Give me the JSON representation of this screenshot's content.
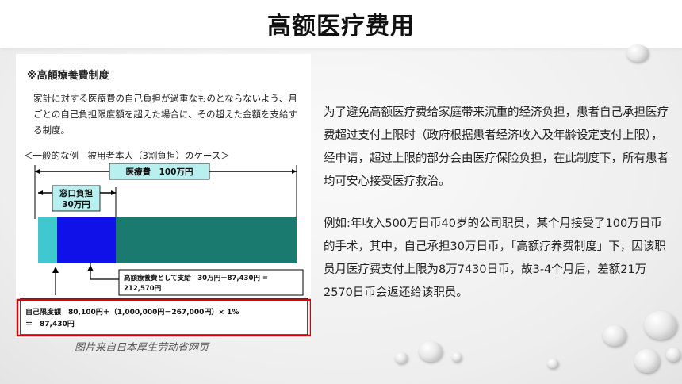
{
  "slide": {
    "title": "高额医疗费用",
    "caption": "图片来自日本厚生劳动省网页",
    "paragraphs": [
      "为了避免高额医疗费给家庭带来沉重的经济负担，患者自己承担医疗费超过支付上限时（政府根据患者经济收入及年龄设定支付上限），经申请，超过上限的部分会由医疗保险负担，在此制度下，所有患者均可安心接受医疗救治。",
      "例如:年收入500万日币40岁的公司职员，某个月接受了100万日币的手术，其中，自己承担30万日币，「高额疗养费制度」下，因该职员月医疗费支付上限为8万7430日币，故3-4个月后，差额21万2570日币会返还给该职员。"
    ]
  },
  "document": {
    "heading": "※高額療養費制度",
    "description": "家計に対する医療費の自己負担が過重なものとならないよう、月ごとの自己負担限度額を超えた場合に、その超えた金額を支給する制度。",
    "example_title": "＜一般的な例　被用者本人（3割負担）のケース＞",
    "total_label": "医療費　100万円",
    "window_label_1": "窓口負担",
    "window_label_2": "30万円",
    "benefit_line_1": "高額療養費として支給　30万円－87,430円 =",
    "benefit_line_2": "212,570円",
    "limit_line_1": "自己限度額　80,100円＋（1,000,000円－267,000円）× 1%",
    "limit_line_2": "＝　87,430円"
  },
  "colors": {
    "cyan_segment": "#40c8d0",
    "blue_segment": "#1010e8",
    "teal_segment": "#1a7a70",
    "label_box": "#b8f0f0",
    "highlight_border": "#e00000"
  }
}
